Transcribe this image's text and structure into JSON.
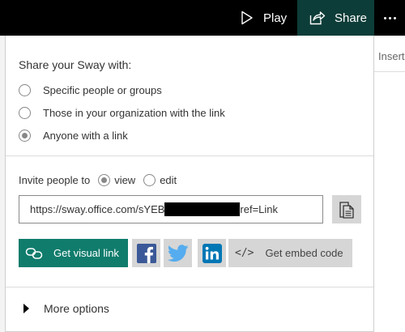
{
  "topbar": {
    "play_label": "Play",
    "share_label": "Share"
  },
  "background": {
    "insert_tab": "Insert"
  },
  "share_panel": {
    "title": "Share your Sway with:",
    "options": [
      {
        "label": "Specific people or groups",
        "selected": false
      },
      {
        "label": "Those in your organization with the link",
        "selected": false
      },
      {
        "label": "Anyone with a link",
        "selected": true
      }
    ],
    "invite": {
      "label": "Invite people to",
      "view_label": "view",
      "edit_label": "edit",
      "selected": "view"
    },
    "link": {
      "prefix": "https://sway.office.com/sYEB",
      "suffix": "ref=Link"
    },
    "visual_link_label": "Get visual link",
    "embed_label": "Get embed code",
    "embed_icon_text": "</>",
    "more_options_label": "More options"
  },
  "colors": {
    "topbar_bg": "#000000",
    "share_active_bg": "#0d3d38",
    "visual_link_bg": "#107c6c",
    "facebook": "#3b5998",
    "twitter": "#55acee",
    "linkedin": "#0077b5",
    "icon_button_bg": "#d6d6d6"
  },
  "icons": [
    "play-icon",
    "share-icon",
    "more-icon",
    "copy-icon",
    "link-icon",
    "facebook-icon",
    "twitter-icon",
    "linkedin-icon",
    "code-icon",
    "caret-right-icon"
  ]
}
